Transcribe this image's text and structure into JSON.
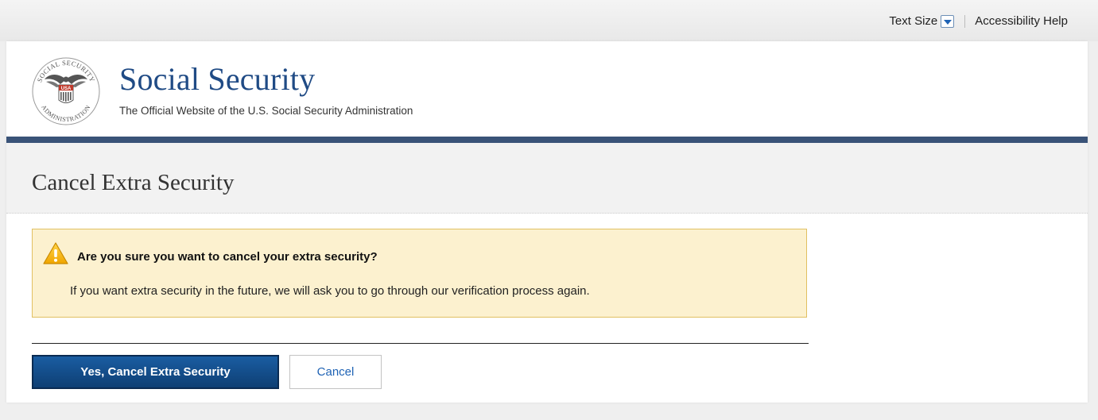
{
  "util": {
    "text_size_label": "Text Size",
    "text_size_icon": "chevron-down-icon",
    "accessibility_help": "Accessibility Help"
  },
  "header": {
    "seal": {
      "top_text": "SOCIAL SECURITY",
      "bottom_text": "ADMINISTRATION",
      "shield_text": "USA"
    },
    "title": "Social Security",
    "subtitle": "The Official Website of the U.S. Social Security Administration"
  },
  "page": {
    "title": "Cancel Extra Security"
  },
  "alert": {
    "icon": "warning-icon",
    "title": "Are you sure you want to cancel your extra security?",
    "body": "If you want extra security in the future, we will ask you to go through our verification process again."
  },
  "actions": {
    "confirm_label": "Yes, Cancel Extra Security",
    "cancel_label": "Cancel"
  },
  "colors": {
    "brand_blue": "#204b85",
    "rule": "#3a5378",
    "alert_bg": "#fcf1cf",
    "alert_border": "#e1c062",
    "primary_button": "#1a5da2",
    "link_blue": "#1f63b5"
  }
}
